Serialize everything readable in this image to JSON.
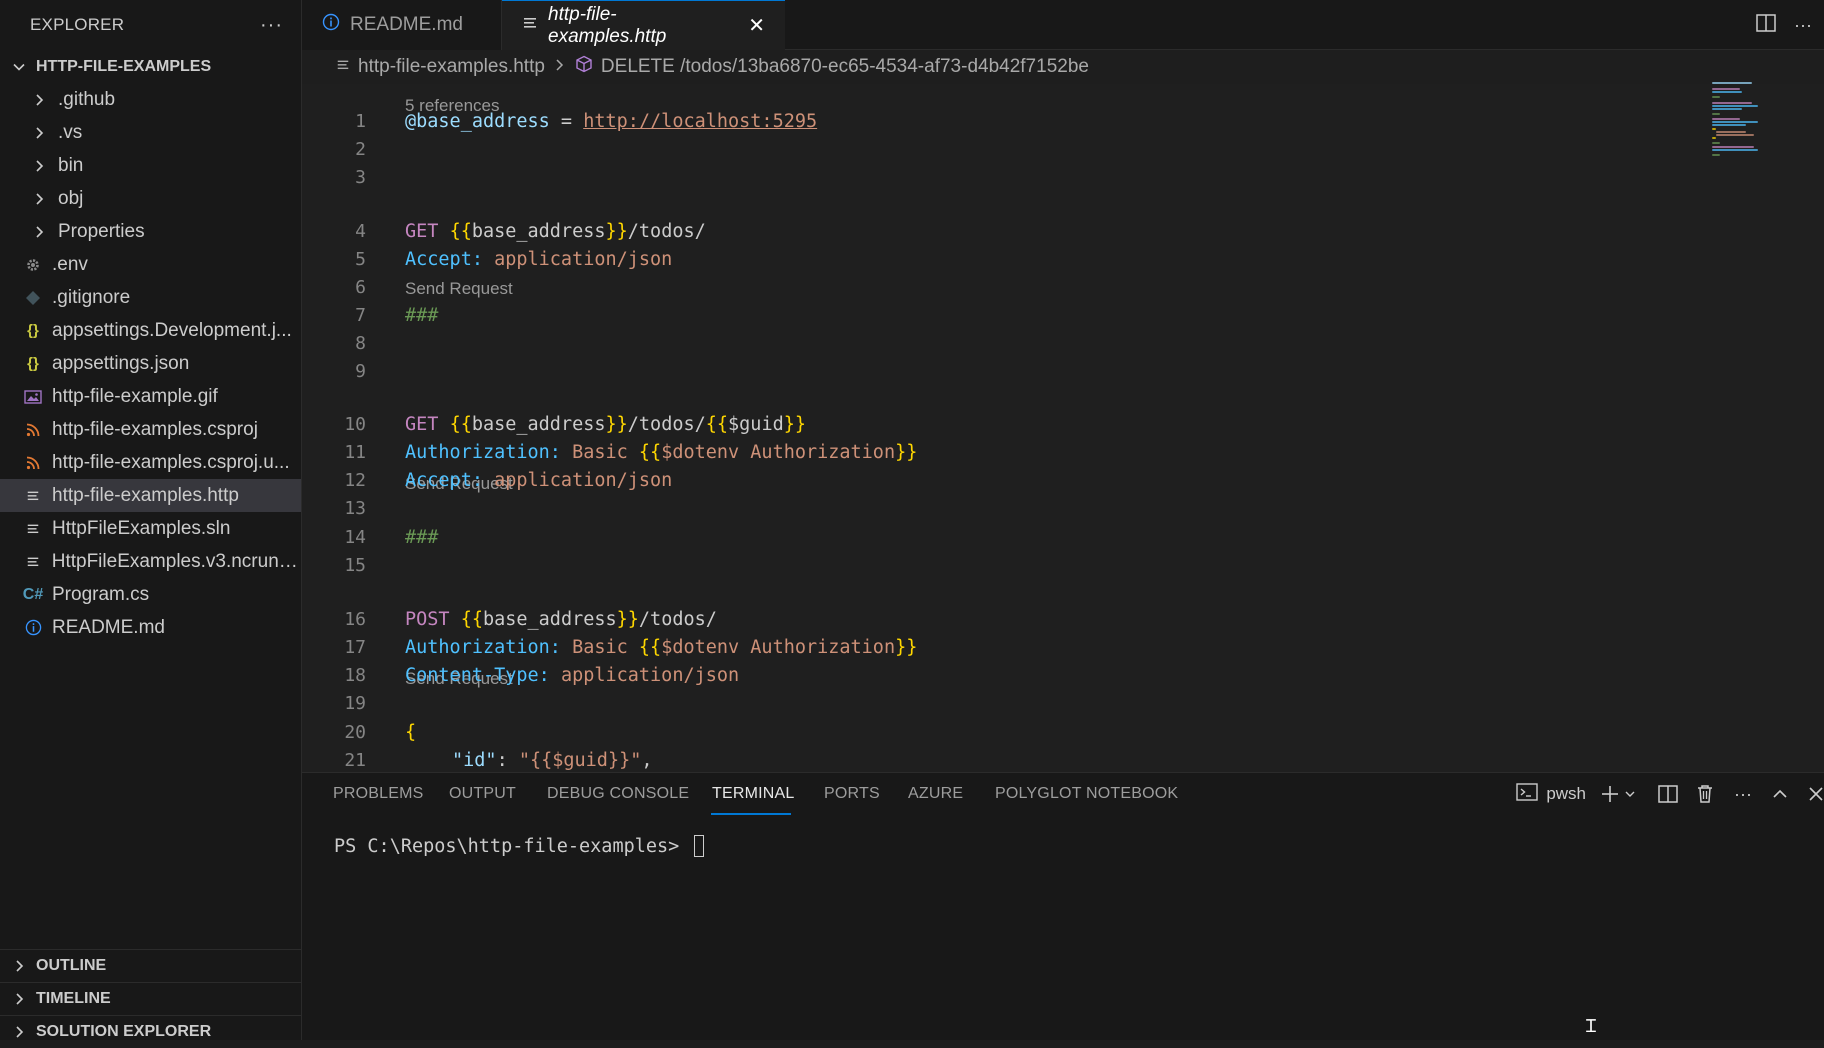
{
  "sidebar": {
    "title": "EXPLORER",
    "root_label": "HTTP-FILE-EXAMPLES",
    "items": [
      {
        "label": ".github",
        "kind": "folder",
        "icon": "chevron-right-icon"
      },
      {
        "label": ".vs",
        "kind": "folder",
        "icon": "chevron-right-icon"
      },
      {
        "label": "bin",
        "kind": "folder",
        "icon": "chevron-right-icon"
      },
      {
        "label": "obj",
        "kind": "folder",
        "icon": "chevron-right-icon"
      },
      {
        "label": "Properties",
        "kind": "folder",
        "icon": "chevron-right-icon"
      },
      {
        "label": ".env",
        "kind": "file",
        "icon": "gear-icon"
      },
      {
        "label": ".gitignore",
        "kind": "file",
        "icon": "git-icon"
      },
      {
        "label": "appsettings.Development.j...",
        "kind": "file",
        "icon": "json-icon"
      },
      {
        "label": "appsettings.json",
        "kind": "file",
        "icon": "json-icon"
      },
      {
        "label": "http-file-example.gif",
        "kind": "file",
        "icon": "image-icon"
      },
      {
        "label": "http-file-examples.csproj",
        "kind": "file",
        "icon": "rss-icon"
      },
      {
        "label": "http-file-examples.csproj.u...",
        "kind": "file",
        "icon": "rss-icon"
      },
      {
        "label": "http-file-examples.http",
        "kind": "file",
        "icon": "lines-icon",
        "selected": true
      },
      {
        "label": "HttpFileExamples.sln",
        "kind": "file",
        "icon": "lines-icon"
      },
      {
        "label": "HttpFileExamples.v3.ncrunc...",
        "kind": "file",
        "icon": "lines-icon"
      },
      {
        "label": "Program.cs",
        "kind": "file",
        "icon": "csharp-icon"
      },
      {
        "label": "README.md",
        "kind": "file",
        "icon": "info-icon"
      }
    ],
    "sections": [
      "OUTLINE",
      "TIMELINE",
      "SOLUTION EXPLORER"
    ]
  },
  "tabs": [
    {
      "label": "README.md",
      "icon": "info-icon",
      "active": false
    },
    {
      "label": "http-file-examples.http",
      "icon": "lines-icon",
      "active": true
    }
  ],
  "breadcrumb": {
    "file": "http-file-examples.http",
    "symbol": "DELETE /todos/13ba6870-ec65-4534-af73-d4b42f7152be"
  },
  "editor": {
    "references_lens": "5 references",
    "send_request_lens": "Send Request",
    "lines": {
      "l1_var": "@base_address",
      "l1_eq": " = ",
      "l1_url": "http://localhost:5295",
      "l4_method": "GET",
      "l4_var": "base_address",
      "l4_path": "/todos/",
      "l5_header": "Accept:",
      "l5_value": "application/json",
      "sep": "###",
      "l10_method": "GET",
      "l10_var": "base_address",
      "l10_path": "/todos/",
      "l10_guid": "$guid",
      "l11_header": "Authorization:",
      "l11_value": "Basic ",
      "l11_dotenv": "$dotenv Authorization",
      "l12_header": "Accept:",
      "l12_value": "application/json",
      "l16_method": "POST",
      "l16_var": "base_address",
      "l16_path": "/todos/",
      "l17_header": "Authorization:",
      "l17_value": "Basic ",
      "l17_dotenv": "$dotenv Authorization",
      "l18_header": "Content-Type:",
      "l18_value": "application/json",
      "l20_brace": "{",
      "l21_key": "\"id\"",
      "l21_colon": ": ",
      "l21_val": "\"{{$guid}}\"",
      "l21_comma": ","
    },
    "line_numbers": [
      "1",
      "2",
      "3",
      "4",
      "5",
      "6",
      "7",
      "8",
      "9",
      "10",
      "11",
      "12",
      "13",
      "14",
      "15",
      "16",
      "17",
      "18",
      "19",
      "20",
      "21"
    ]
  },
  "panel": {
    "tabs": [
      "PROBLEMS",
      "OUTPUT",
      "DEBUG CONSOLE",
      "TERMINAL",
      "PORTS",
      "AZURE",
      "POLYGLOT NOTEBOOK"
    ],
    "active_tab": "TERMINAL",
    "shell_label": "pwsh",
    "prompt": "PS C:\\Repos\\http-file-examples> "
  },
  "colors": {
    "accent": "#0078d4",
    "background": "#1e1e1e",
    "sidebar_bg": "#181818"
  }
}
